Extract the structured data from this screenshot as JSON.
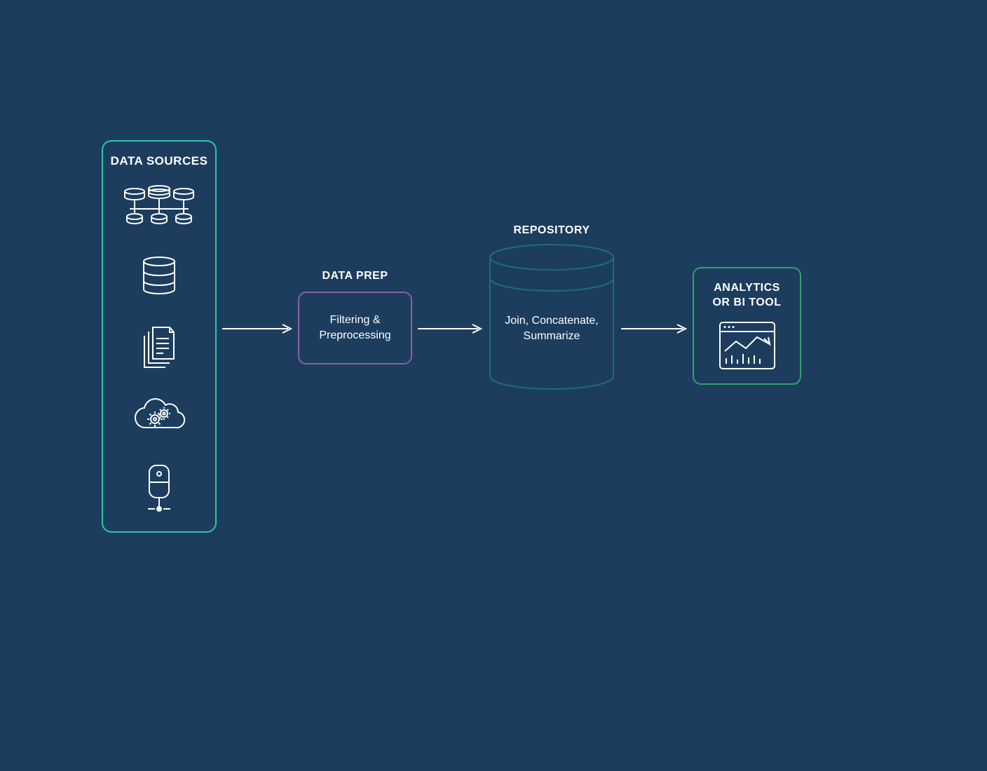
{
  "stages": {
    "data_sources": {
      "label": "DATA SOURCES"
    },
    "data_prep": {
      "label": "DATA PREP",
      "body": "Filtering & Preprocessing"
    },
    "repository": {
      "label": "REPOSITORY",
      "body": "Join, Concatenate, Summarize"
    },
    "analytics": {
      "label_line1": "ANALYTICS",
      "label_line2": "OR BI TOOL"
    }
  },
  "colors": {
    "bg": "#1c3d5e",
    "teal": "#2bc7b0",
    "purple": "#8a5fa5",
    "dark_teal": "#1f6e73",
    "green": "#35a06f",
    "white": "#ffffff"
  }
}
